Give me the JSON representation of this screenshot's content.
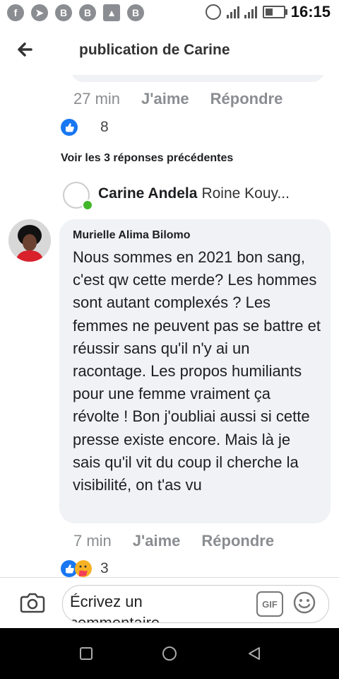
{
  "status_bar": {
    "time": "16:15",
    "left_icons": [
      "facebook-icon",
      "telegram-icon",
      "b-app-icon",
      "b-app-icon",
      "gallery-icon",
      "b-app-icon"
    ],
    "right_icons": [
      "alarm-icon",
      "signal-icon",
      "battery-icon"
    ]
  },
  "app_bar": {
    "title": "publication de Carine"
  },
  "previous_comment": {
    "time": "27 min",
    "like_label": "J'aime",
    "reply_label": "Répondre",
    "reaction_count": "8"
  },
  "see_previous_replies": "Voir les 3 réponses précédentes",
  "carine_reply_preview": {
    "name": "Carine Andela",
    "text": "Roine Kouy..."
  },
  "comment": {
    "author": "Murielle Alima Bilomo",
    "text": "Nous sommes en 2021 bon sang, c'est qw cette merde? Les hommes sont autant complexés ? Les femmes ne peuvent pas se battre et réussir sans qu'il n'y ai un racontage. Les propos humiliants pour une femme vraiment ça révolte ! Bon j'oubliai aussi si cette presse existe encore. Mais là je sais qu'il vit du coup il cherche la visibilité, on t'as vu",
    "time": "7 min",
    "like_label": "J'aime",
    "reply_label": "Répondre",
    "reaction_count": "3"
  },
  "composer": {
    "placeholder": "Écrivez un commentaire",
    "gif_label": "GIF"
  },
  "colors": {
    "facebook_blue": "#1877f2",
    "bubble_gray": "#f0f2f5",
    "online_green": "#42b72a"
  }
}
